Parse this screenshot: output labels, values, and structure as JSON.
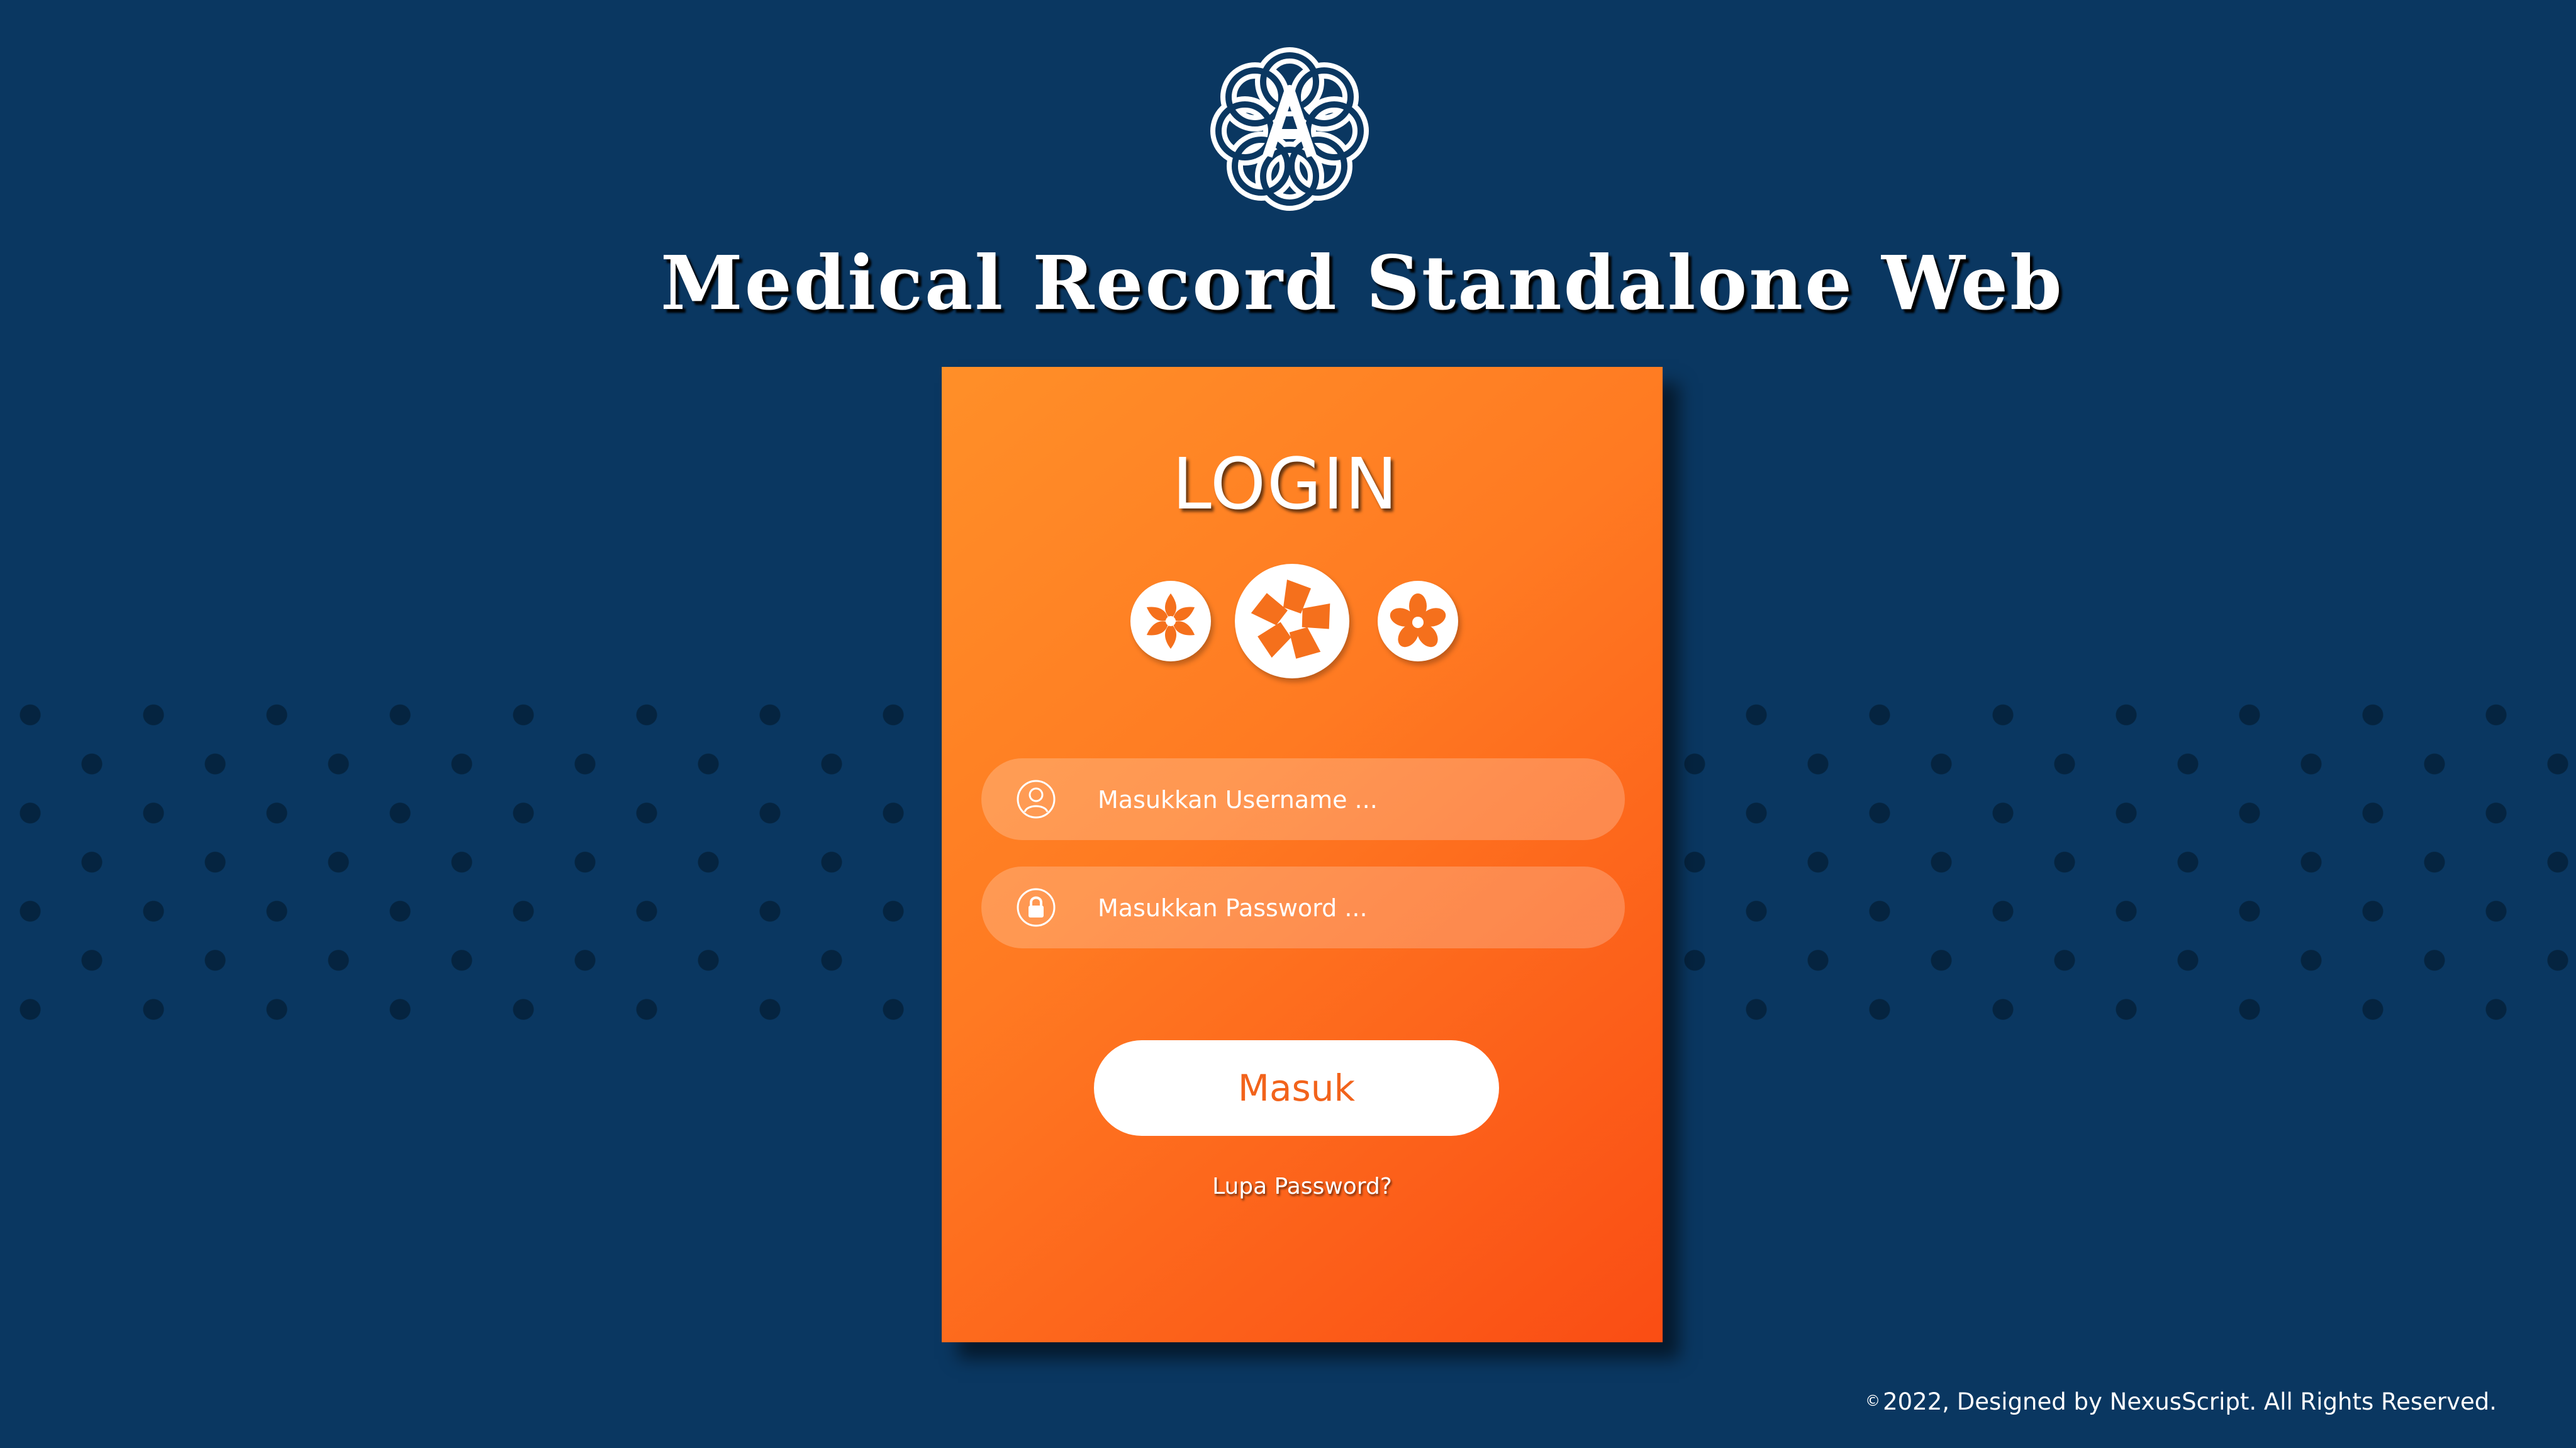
{
  "app": {
    "title": "Medical Record Standalone Web",
    "logo_icon": "flower-a-logo-icon"
  },
  "login": {
    "heading": "LOGIN",
    "emblems": [
      "flower-emblem-icon",
      "pinwheel-emblem-icon",
      "blossom-emblem-icon"
    ],
    "username": {
      "icon": "user-icon",
      "placeholder": "Masukkan Username ...",
      "value": ""
    },
    "password": {
      "icon": "lock-icon",
      "placeholder": "Masukkan Password ...",
      "value": ""
    },
    "submit_label": "Masuk",
    "forgot_label": "Lupa Password?"
  },
  "footer": {
    "symbol": "©",
    "text": "2022, Designed by NexusScript. All Rights Reserved."
  },
  "colors": {
    "background": "#0a3761",
    "card_start": "#ff8f28",
    "card_end": "#fa4d14",
    "button_text": "#f2631b"
  }
}
